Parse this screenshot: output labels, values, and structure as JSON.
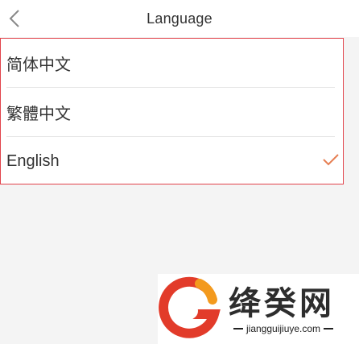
{
  "header": {
    "title": "Language",
    "back_icon": "chevron-left-icon"
  },
  "languages": [
    {
      "label": "简体中文",
      "selected": false
    },
    {
      "label": "繁體中文",
      "selected": false
    },
    {
      "label": "English",
      "selected": true
    }
  ],
  "check_icon": "checkmark-icon",
  "colors": {
    "accent": "#e67e52",
    "highlight_border": "#e1434b",
    "watermark_orange": "#f39a1e",
    "watermark_red": "#e23b2a"
  },
  "watermark": {
    "name": "绛癸网",
    "url": "jiangguijiuye.com"
  }
}
